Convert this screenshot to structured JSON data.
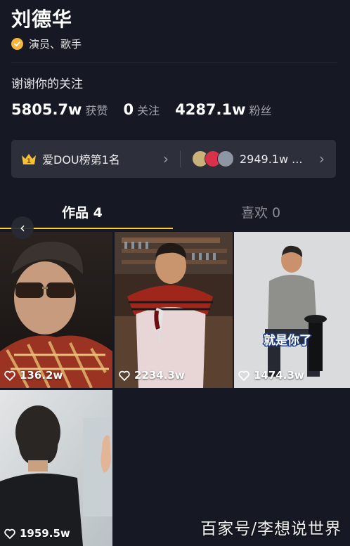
{
  "profile": {
    "name": "刘德华",
    "verified_label": "演员、歌手",
    "bio": "谢谢你的关注"
  },
  "stats": [
    {
      "value": "5805.7w",
      "label": "获赞"
    },
    {
      "value": "0",
      "label": "关注"
    },
    {
      "value": "4287.1w",
      "label": "粉丝"
    }
  ],
  "banner": {
    "rank_badge": "1",
    "rank_text": "爱DOU榜第1名",
    "fans_text": "2949.1w ..."
  },
  "tabs": {
    "works": "作品 4",
    "likes": "喜欢 0"
  },
  "videos": [
    {
      "likes": "136.2w"
    },
    {
      "likes": "2234.3w",
      "caption": ""
    },
    {
      "likes": "1474.3w",
      "caption": "就是你了"
    },
    {
      "likes": "1959.5w"
    }
  ],
  "watermark": "百家号/李想说世界",
  "colors": {
    "background": "#161823",
    "accent": "#fece2a",
    "verified": "#f5b53d"
  }
}
